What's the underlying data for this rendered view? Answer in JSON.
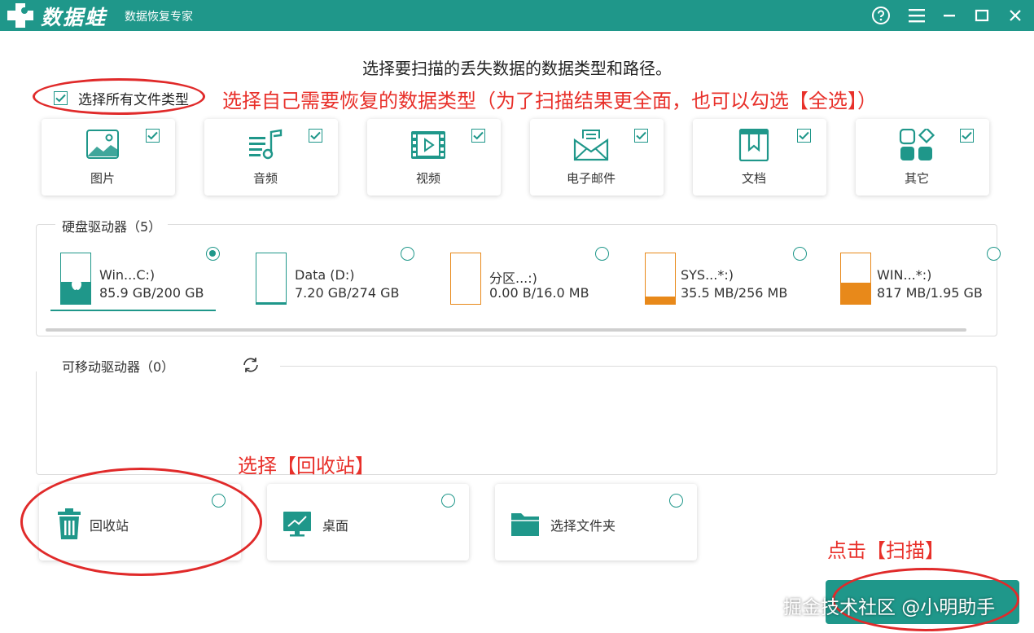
{
  "app": {
    "logo_text": "数据蛙",
    "subtitle": "数据恢复专家"
  },
  "prompt": "选择要扫描的丢失数据的数据类型和路径。",
  "select_all": {
    "label": "选择所有文件类型",
    "checked": true
  },
  "file_types": [
    {
      "label": "图片",
      "icon": "image-icon",
      "checked": true
    },
    {
      "label": "音频",
      "icon": "music-icon",
      "checked": true
    },
    {
      "label": "视频",
      "icon": "video-icon",
      "checked": true
    },
    {
      "label": "电子邮件",
      "icon": "email-icon",
      "checked": true
    },
    {
      "label": "文档",
      "icon": "document-icon",
      "checked": true
    },
    {
      "label": "其它",
      "icon": "other-icon",
      "checked": true
    }
  ],
  "hard_drives": {
    "title": "硬盘驱动器（5）",
    "items": [
      {
        "name": "Win...C:)",
        "size": "85.9 GB/200 GB",
        "selected": true,
        "fill_ratio": 0.43,
        "fill_color": "#1f978a"
      },
      {
        "name": "Data (D:)",
        "size": "7.20 GB/274 GB",
        "selected": false,
        "fill_ratio": 0.03,
        "fill_color": "#1f978a"
      },
      {
        "name": "分区...:)",
        "size": "0.00  B/16.0 MB",
        "selected": false,
        "fill_ratio": 0.0,
        "fill_color": "#e8891a"
      },
      {
        "name": "SYS...*:)",
        "size": "35.5 MB/256 MB",
        "selected": false,
        "fill_ratio": 0.14,
        "fill_color": "#e8891a"
      },
      {
        "name": "WIN...*:)",
        "size": "817 MB/1.95 GB",
        "selected": false,
        "fill_ratio": 0.42,
        "fill_color": "#e8891a"
      }
    ]
  },
  "removable": {
    "title": "可移动驱动器（0）"
  },
  "locations": [
    {
      "label": "回收站",
      "icon": "trash-icon"
    },
    {
      "label": "桌面",
      "icon": "desktop-icon"
    },
    {
      "label": "选择文件夹",
      "icon": "folder-icon"
    }
  ],
  "annotations": {
    "select_types": "选择自己需要恢复的数据类型（为了扫描结果更全面，也可以勾选【全选】）",
    "select_recycle": "选择【回收站】",
    "click_scan": "点击【扫描】"
  },
  "watermark": "掘金技术社区 @小明助手",
  "colors": {
    "accent": "#1f978a",
    "annotation": "#e8302a",
    "warning": "#e8891a"
  }
}
